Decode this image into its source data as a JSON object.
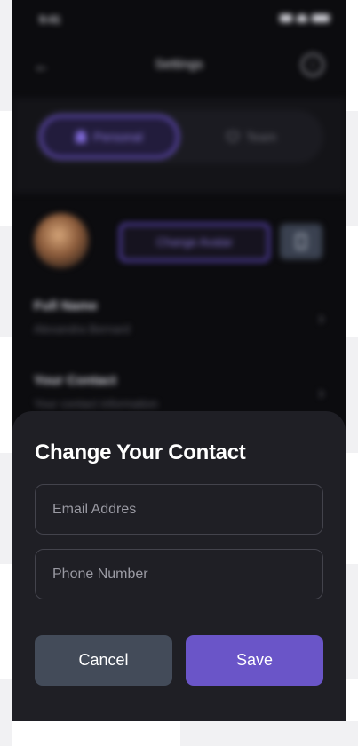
{
  "status_bar": {
    "time": "9:41"
  },
  "header": {
    "title": "Settings"
  },
  "tabs": [
    {
      "label": "Personal",
      "active": true
    },
    {
      "label": "Team",
      "active": false
    }
  ],
  "profile": {
    "change_avatar_label": "Change Avatar"
  },
  "rows": [
    {
      "title": "Full Name",
      "value": "Alexandra Bernard"
    },
    {
      "title": "Your Contact",
      "value": "Your contact information"
    }
  ],
  "sheet": {
    "title": "Change Your Contact",
    "email_placeholder": "Email Addres",
    "phone_placeholder": "Phone Number",
    "cancel_label": "Cancel",
    "save_label": "Save"
  },
  "colors": {
    "accent": "#6a55c8",
    "sheet_bg": "#1f1f25",
    "cancel_bg": "#434b59"
  },
  "icons": [
    "back-arrow-icon",
    "info-icon",
    "person-icon",
    "team-icon",
    "trash-icon",
    "chevron-right-icon"
  ]
}
